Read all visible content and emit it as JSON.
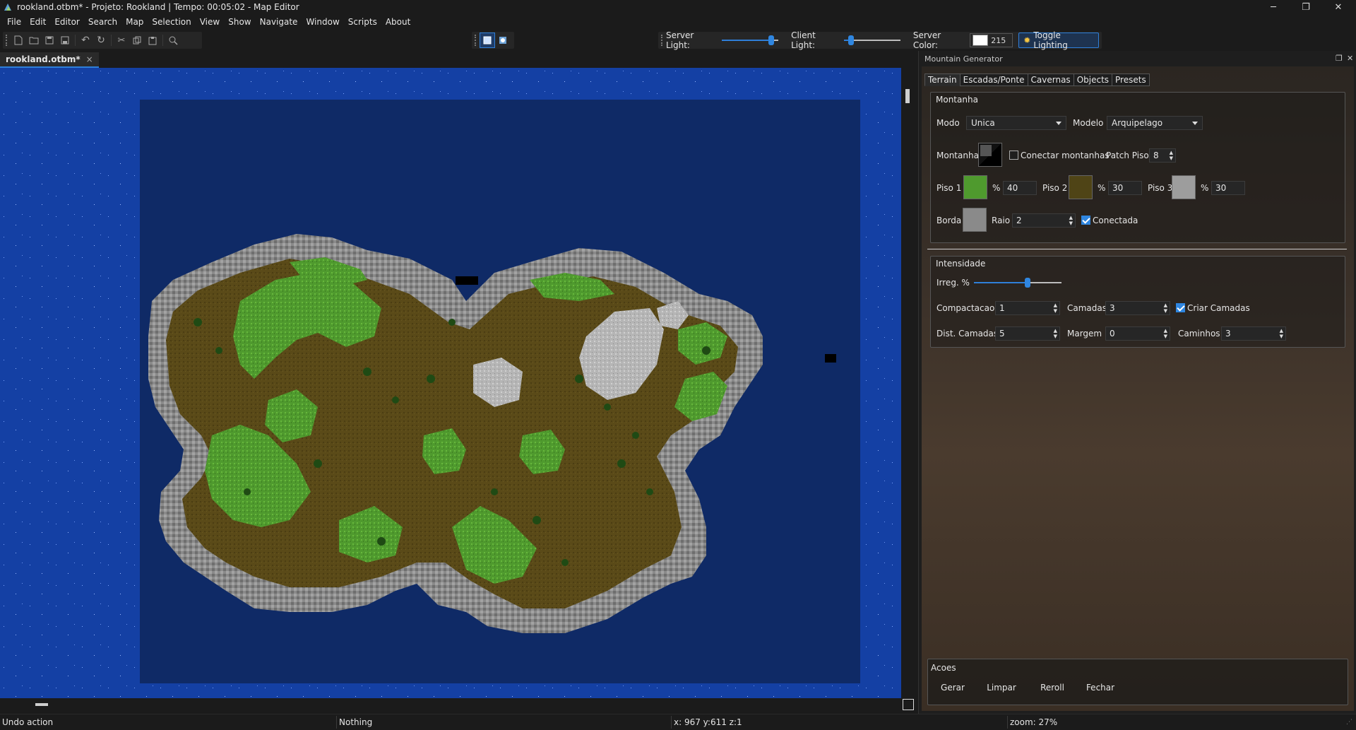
{
  "window": {
    "title": "rookland.otbm* - Projeto: Rookland | Tempo: 00:05:02 - Map Editor",
    "controls": [
      "minimize-icon",
      "restore-icon",
      "close-icon"
    ]
  },
  "menu": [
    "File",
    "Edit",
    "Editor",
    "Search",
    "Map",
    "Selection",
    "View",
    "Show",
    "Navigate",
    "Window",
    "Scripts",
    "About"
  ],
  "toolbar": {
    "icons": [
      "new-file-icon",
      "open-folder-icon",
      "save-icon",
      "save-as-icon",
      "undo-icon",
      "redo-icon",
      "cut-icon",
      "copy-icon",
      "paste-icon",
      "zoom-icon"
    ],
    "server_light_label": "Server Light:",
    "server_light_value": 0.92,
    "client_light_label": "Client Light:",
    "client_light_value": 0.08,
    "server_color_label": "Server Color:",
    "server_color_value": "215",
    "server_color_swatch": "#ffffff",
    "toggle_lighting_label": "Toggle Lighting"
  },
  "document_tab": {
    "label": "rookland.otbm*",
    "close": "×"
  },
  "map": {
    "water_color": "#14399a",
    "inner_water_color": "#0f2a66"
  },
  "panel": {
    "title": "Mountain Generator",
    "tabs": [
      "Terrain",
      "Escadas/Ponte",
      "Cavernas",
      "Objects",
      "Presets"
    ],
    "active_tab": "Terrain",
    "montanha": {
      "title": "Montanha",
      "modo_label": "Modo",
      "modo_value": "Unica",
      "modelo_label": "Modelo",
      "modelo_value": "Arquipelago",
      "montanha_label": "Montanha",
      "conectar_label": "Conectar montanhas",
      "conectar_checked": false,
      "patch_piso_label": "Patch Piso",
      "patch_piso_value": "8",
      "piso1_label": "Piso 1",
      "piso1_pct": "40",
      "piso2_label": "Piso 2",
      "piso2_pct": "30",
      "piso3_label": "Piso 3",
      "piso3_pct": "30",
      "pct_symbol": "%",
      "borda_label": "Borda",
      "raio_label": "Raio",
      "raio_value": "2",
      "conectada_label": "Conectada",
      "conectada_checked": true
    },
    "intensidade": {
      "title": "Intensidade",
      "irreg_label": "Irreg. %",
      "irreg_value": 0.62,
      "compactacao_label": "Compactacao",
      "compactacao_value": "1",
      "camadas_label": "Camadas",
      "camadas_value": "3",
      "criar_camadas_label": "Criar Camadas",
      "criar_camadas_checked": true,
      "dist_camadas_label": "Dist. Camadas",
      "dist_camadas_value": "5",
      "margem_label": "Margem",
      "margem_value": "0",
      "caminhos_label": "Caminhos",
      "caminhos_value": "3"
    },
    "acoes": {
      "title": "Acoes",
      "buttons": [
        "Gerar",
        "Limpar",
        "Reroll",
        "Fechar"
      ]
    }
  },
  "status": {
    "left": "Undo action",
    "mid": "Nothing",
    "coords": "x: 967 y:611 z:1",
    "zoom": "zoom: 27%"
  }
}
